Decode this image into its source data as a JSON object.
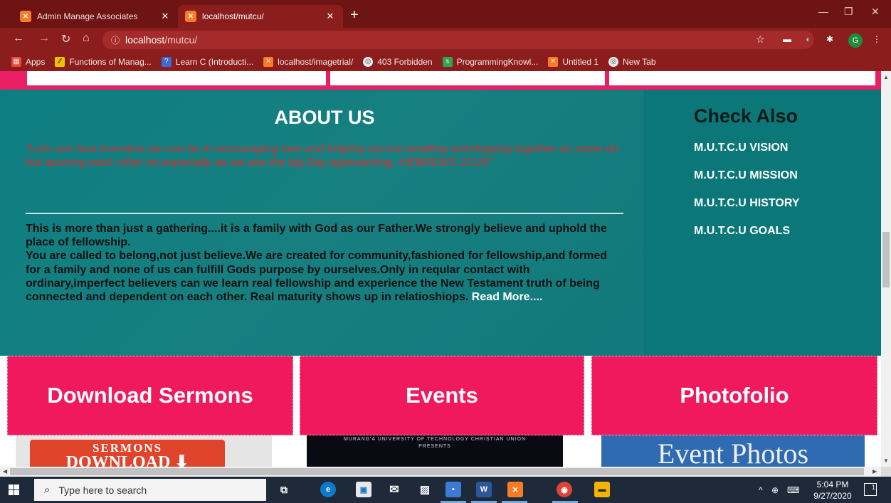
{
  "browser": {
    "tabs": [
      {
        "label": "Admin Manage Associates",
        "favicon": "xampp-icon"
      },
      {
        "label": "localhost/mutcu/",
        "favicon": "xampp-icon"
      }
    ],
    "url_host": "localhost",
    "url_path": "/mutcu/",
    "avatar_letter": "G",
    "bookmarks": [
      {
        "label": "Apps"
      },
      {
        "label": "Functions of Manag..."
      },
      {
        "label": "Learn C (Introducti..."
      },
      {
        "label": "localhost/imagetrial/"
      },
      {
        "label": "403 Forbidden"
      },
      {
        "label": "ProgrammingKnowl..."
      },
      {
        "label": "Untitled 1"
      },
      {
        "label": "New Tab"
      }
    ]
  },
  "about": {
    "title": "ABOUT US",
    "quote": "\"Lets see how inventive we can be in encouraging love and helping out,not avoiding worshipping together as some do but spurring each other on,especially as we see the big Day approaching.-HEBREWS 10:25\"",
    "para1": "This is more than just a gathering....it is a family with God as our Father.We strongly believe and uphold the place of fellowship.",
    "para2": "You are called to belong,not just believe.We are created for community,fashioned for fellowship,and formed for a family and none of us can fulfill Gods purpose by ourselves.Only in reqular contact with ordinary,imperfect believers can we learn real fellowship and experience the New Testament truth of being connected and dependent on each other. Real maturity shows up in relatioshiops.",
    "read_more": "Read More...."
  },
  "check_also": {
    "title": "Check Also",
    "links": [
      "M.U.T.C.U VISION",
      "M.U.T.C.U MISSION",
      "M.U.T.C.U HISTORY",
      "M.U.T.C.U GOALS"
    ]
  },
  "cards": [
    {
      "title": "Download Sermons",
      "image_line1": "SERMONS",
      "image_line2": "DOWNLOAD"
    },
    {
      "title": "Events",
      "image_line1": "MURANG'A UNIVERSITY OF TECHNOLOGY CHRISTIAN UNION",
      "image_line2": "PRESENTS"
    },
    {
      "title": "Photofolio",
      "image_line1": "Event Photos"
    }
  ],
  "taskbar": {
    "search_placeholder": "Type here to search",
    "time": "5:04 PM",
    "date": "9/27/2020",
    "notif_count": "1"
  },
  "colors": {
    "chrome_tabstrip": "#6e1414",
    "chrome_toolbar": "#8b1d1d",
    "about_bg": "#0d7f82",
    "card_pink": "#f0195e",
    "quote_red": "#d32f2f"
  }
}
